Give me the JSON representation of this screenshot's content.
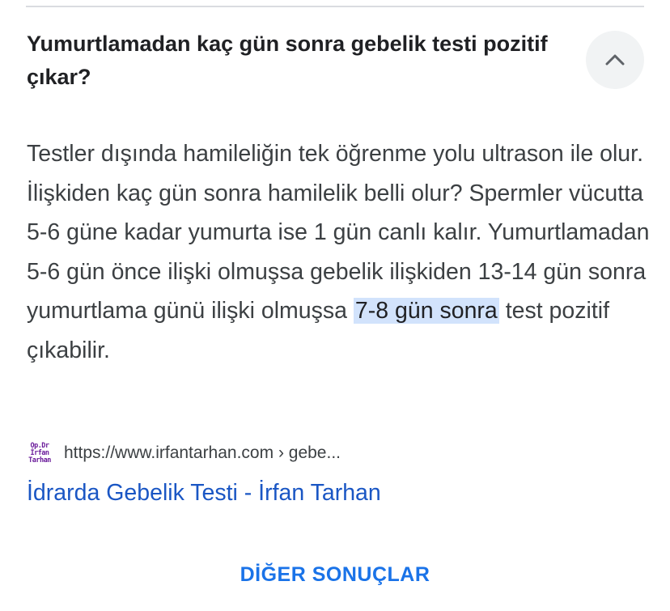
{
  "faq": {
    "question": "Yumurtlamadan kaç gün sonra gebelik testi pozitif çıkar?",
    "collapse_icon": "chevron-up-icon",
    "answer_before": "Testler dışında hamileliğin tek öğrenme yolu ultrason ile olur. İlişkiden kaç gün sonra hamilelik belli olur? Spermler vücutta 5-6 güne kadar yumurta ise 1 gün canlı kalır. Yumurtlamadan 5-6 gün önce ilişki olmuşsa gebelik ilişkiden 13-14 gün sonra yumurtlama günü ilişki olmuşsa ",
    "answer_highlight": "7-8 gün sonra",
    "answer_after": " test pozitif çıkabilir."
  },
  "source": {
    "favicon_text": [
      "Op.Dr",
      "İrfan",
      "Tarhan"
    ],
    "url": "https://www.irfantarhan.com › gebe...",
    "link_title": "İdrarda Gebelik Testi - İrfan Tarhan"
  },
  "more_results_label": "DİĞER SONUÇLAR",
  "colors": {
    "link": "#1a56c4",
    "accent": "#1a73e8",
    "highlight": "#d2e3fc",
    "favicon": "#6a1b9a"
  }
}
